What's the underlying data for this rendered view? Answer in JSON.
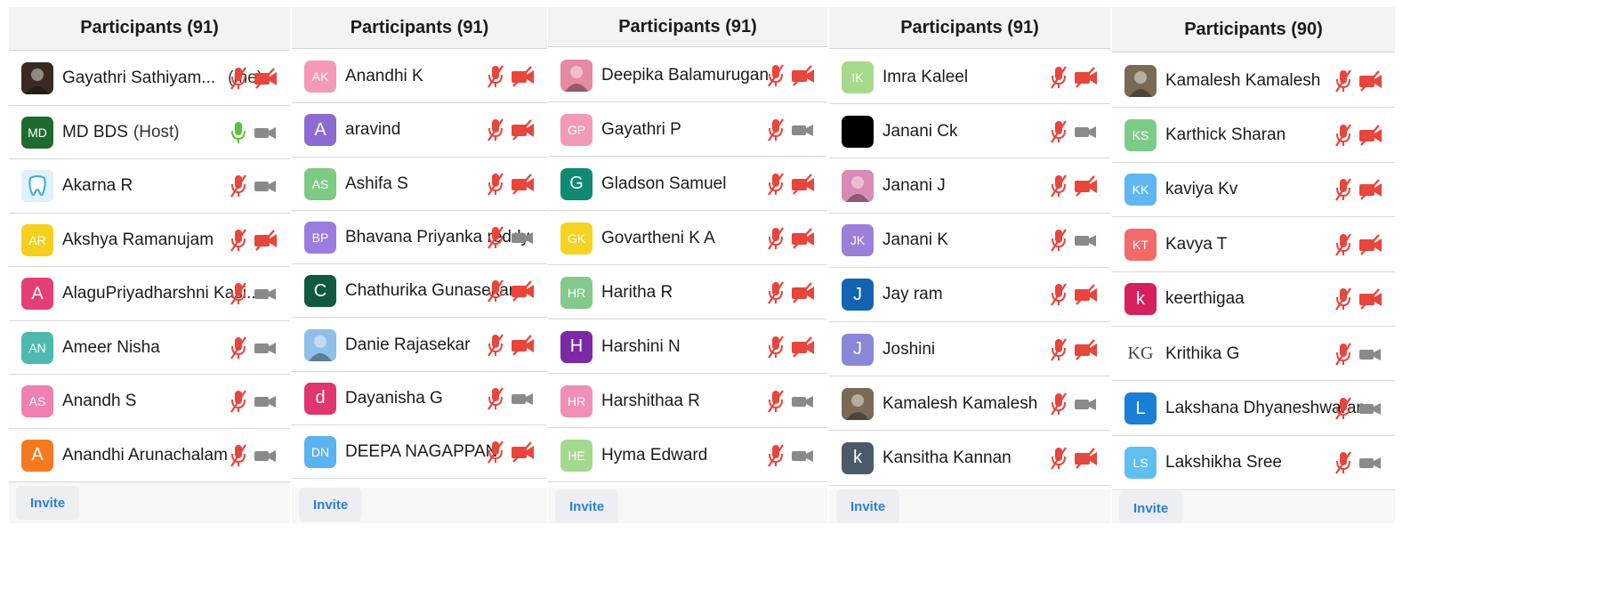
{
  "colors": {
    "header_bg": "#f3f3f3",
    "mute_red": "#e8453c",
    "unmute_green": "#5bc236",
    "video_gray": "#8a8a8a",
    "invite_blue": "#2d7fd2"
  },
  "panels": [
    {
      "title": "Participants (91)",
      "invite_label": "Invite",
      "rows": [
        {
          "name": "Gayathri Sathiyam...",
          "tag": "(me)",
          "avatar_text": "",
          "avatar_color": "#3a2a22",
          "avatar_icon": "photo-avatar",
          "mic": "muted",
          "video": "off"
        },
        {
          "name": "MD BDS",
          "tag": "(Host)",
          "avatar_text": "MD",
          "avatar_color": "#1e6b2f",
          "mic": "on",
          "video": "on-gray"
        },
        {
          "name": "Akarna R",
          "tag": "",
          "avatar_text": "",
          "avatar_color": "#3fa9df",
          "avatar_icon": "tooth-avatar",
          "mic": "muted",
          "video": "on-gray"
        },
        {
          "name": "Akshya Ramanujam",
          "tag": "",
          "avatar_text": "AR",
          "avatar_color": "#f4d01d",
          "mic": "muted",
          "video": "off"
        },
        {
          "name": "AlaguPriyadharshni Kasi...",
          "tag": "",
          "avatar_text": "A",
          "avatar_color": "#e53e75",
          "mic": "muted",
          "video": "on-gray"
        },
        {
          "name": "Ameer Nisha",
          "tag": "",
          "avatar_text": "AN",
          "avatar_color": "#4dbab0",
          "mic": "muted",
          "video": "on-gray"
        },
        {
          "name": "Anandh S",
          "tag": "",
          "avatar_text": "AS",
          "avatar_color": "#f07fb5",
          "mic": "muted",
          "video": "on-gray"
        },
        {
          "name": "Anandhi Arunachalam",
          "tag": "",
          "avatar_text": "A",
          "avatar_color": "#f47a20",
          "mic": "muted",
          "video": "on-gray"
        }
      ]
    },
    {
      "title": "Participants (91)",
      "invite_label": "Invite",
      "rows": [
        {
          "name": "Anandhi K",
          "tag": "",
          "avatar_text": "AK",
          "avatar_color": "#f49ab5",
          "mic": "muted",
          "video": "off"
        },
        {
          "name": "aravind",
          "tag": "",
          "avatar_text": "A",
          "avatar_color": "#8b6ad1",
          "mic": "muted",
          "video": "off"
        },
        {
          "name": "Ashifa S",
          "tag": "",
          "avatar_text": "AS",
          "avatar_color": "#7dca84",
          "mic": "muted",
          "video": "off"
        },
        {
          "name": "Bhavana Priyanka reddy",
          "tag": "",
          "avatar_text": "BP",
          "avatar_color": "#9c7be0",
          "mic": "muted",
          "video": "on-gray"
        },
        {
          "name": "Chathurika Gunasekar",
          "tag": "",
          "avatar_text": "C",
          "avatar_color": "#0f5a3e",
          "mic": "muted",
          "video": "off"
        },
        {
          "name": "Danie Rajasekar",
          "tag": "",
          "avatar_text": "",
          "avatar_color": "#8fc0e8",
          "avatar_icon": "photo-avatar",
          "mic": "muted",
          "video": "off"
        },
        {
          "name": "Dayanisha G",
          "tag": "",
          "avatar_text": "d",
          "avatar_color": "#e0356f",
          "mic": "muted",
          "video": "on-gray"
        },
        {
          "name": "DEEPA NAGAPPAN",
          "tag": "",
          "avatar_text": "DN",
          "avatar_color": "#5ab2f0",
          "mic": "muted",
          "video": "off"
        }
      ]
    },
    {
      "title": "Participants (91)",
      "invite_label": "Invite",
      "rows": [
        {
          "name": "Deepika Balamurugan",
          "tag": "",
          "avatar_text": "",
          "avatar_color": "#e58aa0",
          "avatar_icon": "photo-avatar",
          "mic": "muted",
          "video": "off"
        },
        {
          "name": "Gayathri P",
          "tag": "",
          "avatar_text": "GP",
          "avatar_color": "#f29ab8",
          "mic": "muted",
          "video": "on-gray"
        },
        {
          "name": "Gladson Samuel",
          "tag": "",
          "avatar_text": "G",
          "avatar_color": "#0e8a73",
          "mic": "muted",
          "video": "off"
        },
        {
          "name": "Govartheni K A",
          "tag": "",
          "avatar_text": "GK",
          "avatar_color": "#f6d320",
          "mic": "muted",
          "video": "off"
        },
        {
          "name": "Haritha R",
          "tag": "",
          "avatar_text": "HR",
          "avatar_color": "#83c98b",
          "mic": "muted",
          "video": "off"
        },
        {
          "name": "Harshini N",
          "tag": "",
          "avatar_text": "H",
          "avatar_color": "#7b2aa5",
          "mic": "muted",
          "video": "off"
        },
        {
          "name": "Harshithaa R",
          "tag": "",
          "avatar_text": "HR",
          "avatar_color": "#f08fb7",
          "mic": "muted",
          "video": "on-gray"
        },
        {
          "name": "Hyma Edward",
          "tag": "",
          "avatar_text": "HE",
          "avatar_color": "#a3d98f",
          "mic": "muted",
          "video": "on-gray"
        }
      ]
    },
    {
      "title": "Participants (91)",
      "invite_label": "Invite",
      "rows": [
        {
          "name": "Imra Kaleel",
          "tag": "",
          "avatar_text": "IK",
          "avatar_color": "#a6d98c",
          "mic": "muted",
          "video": "off"
        },
        {
          "name": "Janani Ck",
          "tag": "",
          "avatar_text": "",
          "avatar_color": "#000000",
          "mic": "muted",
          "video": "on-gray"
        },
        {
          "name": "Janani J",
          "tag": "",
          "avatar_text": "",
          "avatar_color": "#d98bb5",
          "avatar_icon": "photo-avatar",
          "mic": "muted",
          "video": "off"
        },
        {
          "name": "Janani K",
          "tag": "",
          "avatar_text": "JK",
          "avatar_color": "#9b7fd8",
          "mic": "muted",
          "video": "on-gray"
        },
        {
          "name": "Jay ram",
          "tag": "",
          "avatar_text": "J",
          "avatar_color": "#1463b0",
          "mic": "muted",
          "video": "off"
        },
        {
          "name": "Joshini",
          "tag": "",
          "avatar_text": "J",
          "avatar_color": "#8a86d8",
          "mic": "muted",
          "video": "off"
        },
        {
          "name": "Kamalesh Kamalesh",
          "tag": "",
          "avatar_text": "",
          "avatar_color": "#7a6a55",
          "avatar_icon": "photo-avatar",
          "mic": "muted",
          "video": "on-gray"
        },
        {
          "name": "Kansitha Kannan",
          "tag": "",
          "avatar_text": "k",
          "avatar_color": "#4a5a68",
          "mic": "muted",
          "video": "off"
        }
      ]
    },
    {
      "title": "Participants (90)",
      "invite_label": "Invite",
      "rows": [
        {
          "name": "Kamalesh Kamalesh",
          "tag": "",
          "avatar_text": "",
          "avatar_color": "#7a6a55",
          "avatar_icon": "photo-avatar",
          "mic": "muted",
          "video": "off"
        },
        {
          "name": "Karthick Sharan",
          "tag": "",
          "avatar_text": "KS",
          "avatar_color": "#7ecb87",
          "mic": "muted",
          "video": "off"
        },
        {
          "name": "kaviya Kv",
          "tag": "",
          "avatar_text": "KK",
          "avatar_color": "#5fb6f2",
          "mic": "muted",
          "video": "off"
        },
        {
          "name": "Kavya T",
          "tag": "",
          "avatar_text": "KT",
          "avatar_color": "#f26a6a",
          "mic": "muted",
          "video": "off"
        },
        {
          "name": "keerthigaa",
          "tag": "",
          "avatar_text": "k",
          "avatar_color": "#d61f5c",
          "mic": "muted",
          "video": "off"
        },
        {
          "name": "Krithika G",
          "tag": "",
          "avatar_text": "KG",
          "avatar_color": "#ffffff",
          "avatar_icon": "monogram-avatar",
          "mic": "muted",
          "video": "on-gray"
        },
        {
          "name": "Lakshana Dhyaneshwaran",
          "tag": "",
          "avatar_text": "L",
          "avatar_color": "#1a7fd6",
          "mic": "muted",
          "video": "on-gray"
        },
        {
          "name": "Lakshikha Sree",
          "tag": "",
          "avatar_text": "LS",
          "avatar_color": "#5fc0f0",
          "mic": "muted",
          "video": "on-gray"
        }
      ]
    }
  ]
}
